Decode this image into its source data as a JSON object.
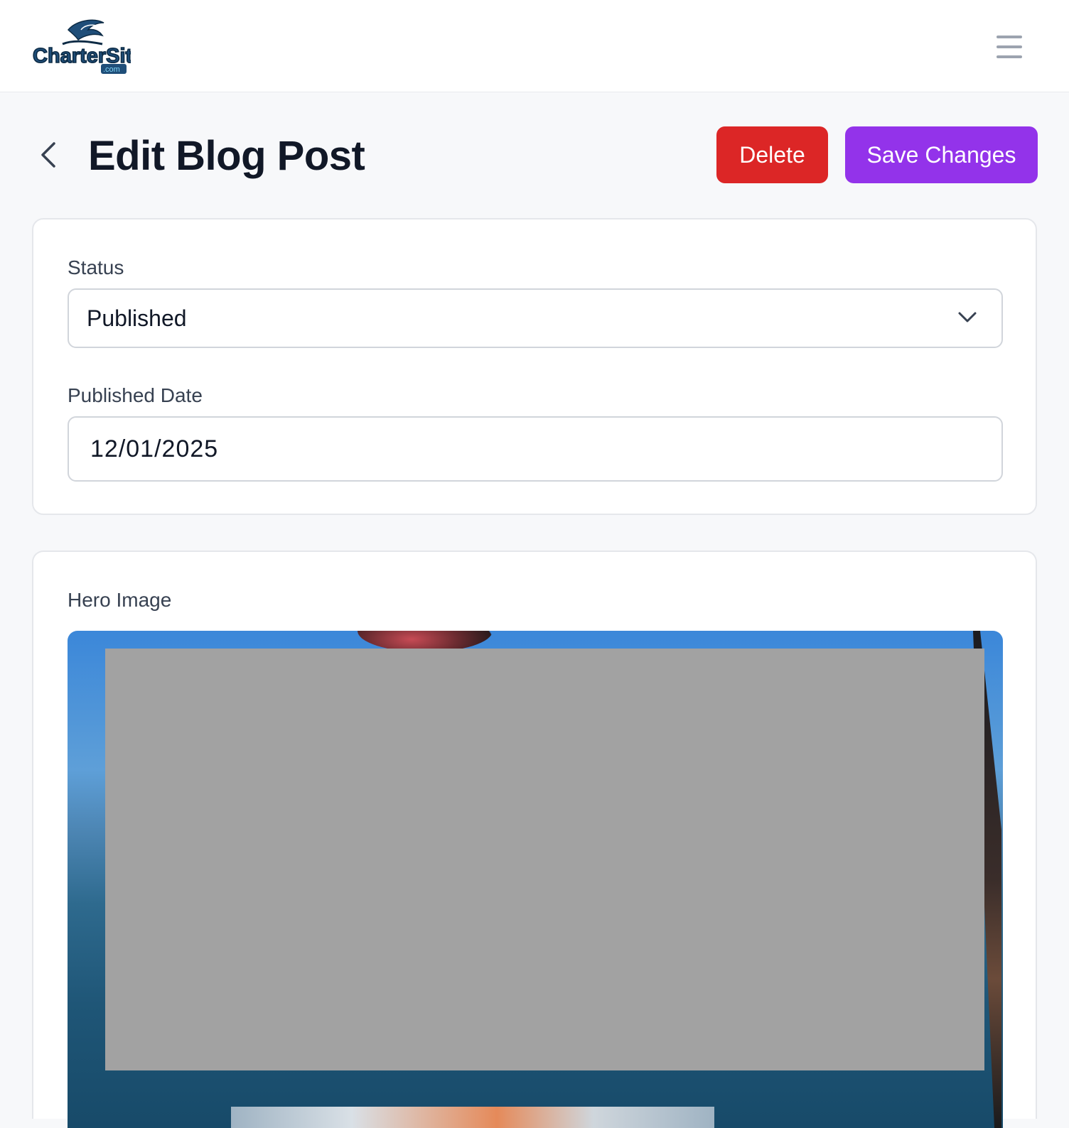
{
  "header": {
    "logo_text": "CharterSites",
    "logo_suffix": ".com",
    "menu_icon": "hamburger-menu-icon"
  },
  "page": {
    "back_icon": "chevron-left-icon",
    "title": "Edit Blog Post",
    "delete_label": "Delete",
    "save_label": "Save Changes"
  },
  "status_card": {
    "status_label": "Status",
    "status_value": "Published",
    "date_label": "Published Date",
    "date_value": "12/01/2025"
  },
  "hero_card": {
    "label": "Hero Image",
    "image_description": "fishing-photo-redacted"
  },
  "colors": {
    "delete": "#dc2626",
    "save": "#9333ea",
    "background": "#f7f8fa",
    "title": "#111827"
  }
}
